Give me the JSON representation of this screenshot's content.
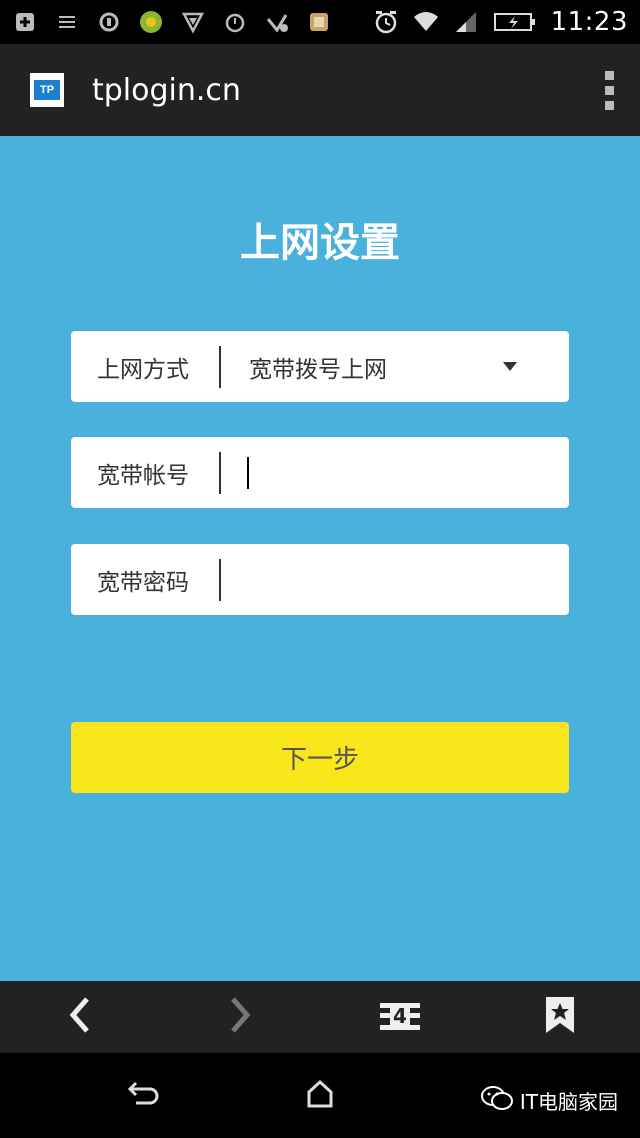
{
  "status_bar": {
    "time": "11:23",
    "icons": [
      "add-icon",
      "menu-lines-icon",
      "sync-icon",
      "app-icon",
      "shield-icon",
      "alarm-icon",
      "check-shield-icon",
      "store-icon",
      "alarm-clock-icon",
      "wifi-icon",
      "signal-icon",
      "battery-charging-icon"
    ]
  },
  "browser": {
    "url": "tplogin.cn",
    "logo_text": "TP",
    "tab_count": "4"
  },
  "page": {
    "title": "上网设置",
    "connection_type_label": "上网方式",
    "connection_type_value": "宽带拨号上网",
    "account_label": "宽带帐号",
    "account_value": "",
    "password_label": "宽带密码",
    "password_value": "",
    "next_button": "下一步"
  },
  "watermark": {
    "text": "IT电脑家园"
  },
  "colors": {
    "page_background": "#4ab1dc",
    "button": "#f9e61b",
    "toolbar": "#222222"
  }
}
